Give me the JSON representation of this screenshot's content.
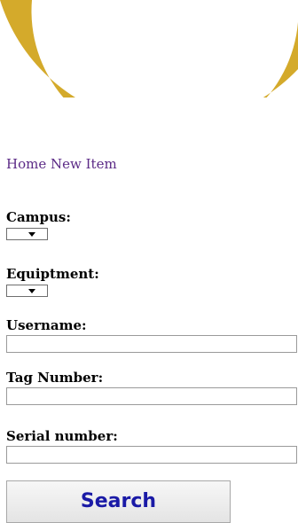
{
  "colors": {
    "logo_gold": "#D4AA2B",
    "nav_link": "#5b2a86",
    "button_text": "#1a1aa6"
  },
  "nav": {
    "home": "Home",
    "new_item": "New Item"
  },
  "form": {
    "campus_label": "Campus:",
    "equipment_label": "Equiptment:",
    "username_label": "Username:",
    "username_value": "",
    "tag_label": "Tag Number:",
    "tag_value": "",
    "serial_label": "Serial number:",
    "serial_value": "",
    "search_label": "Search"
  }
}
